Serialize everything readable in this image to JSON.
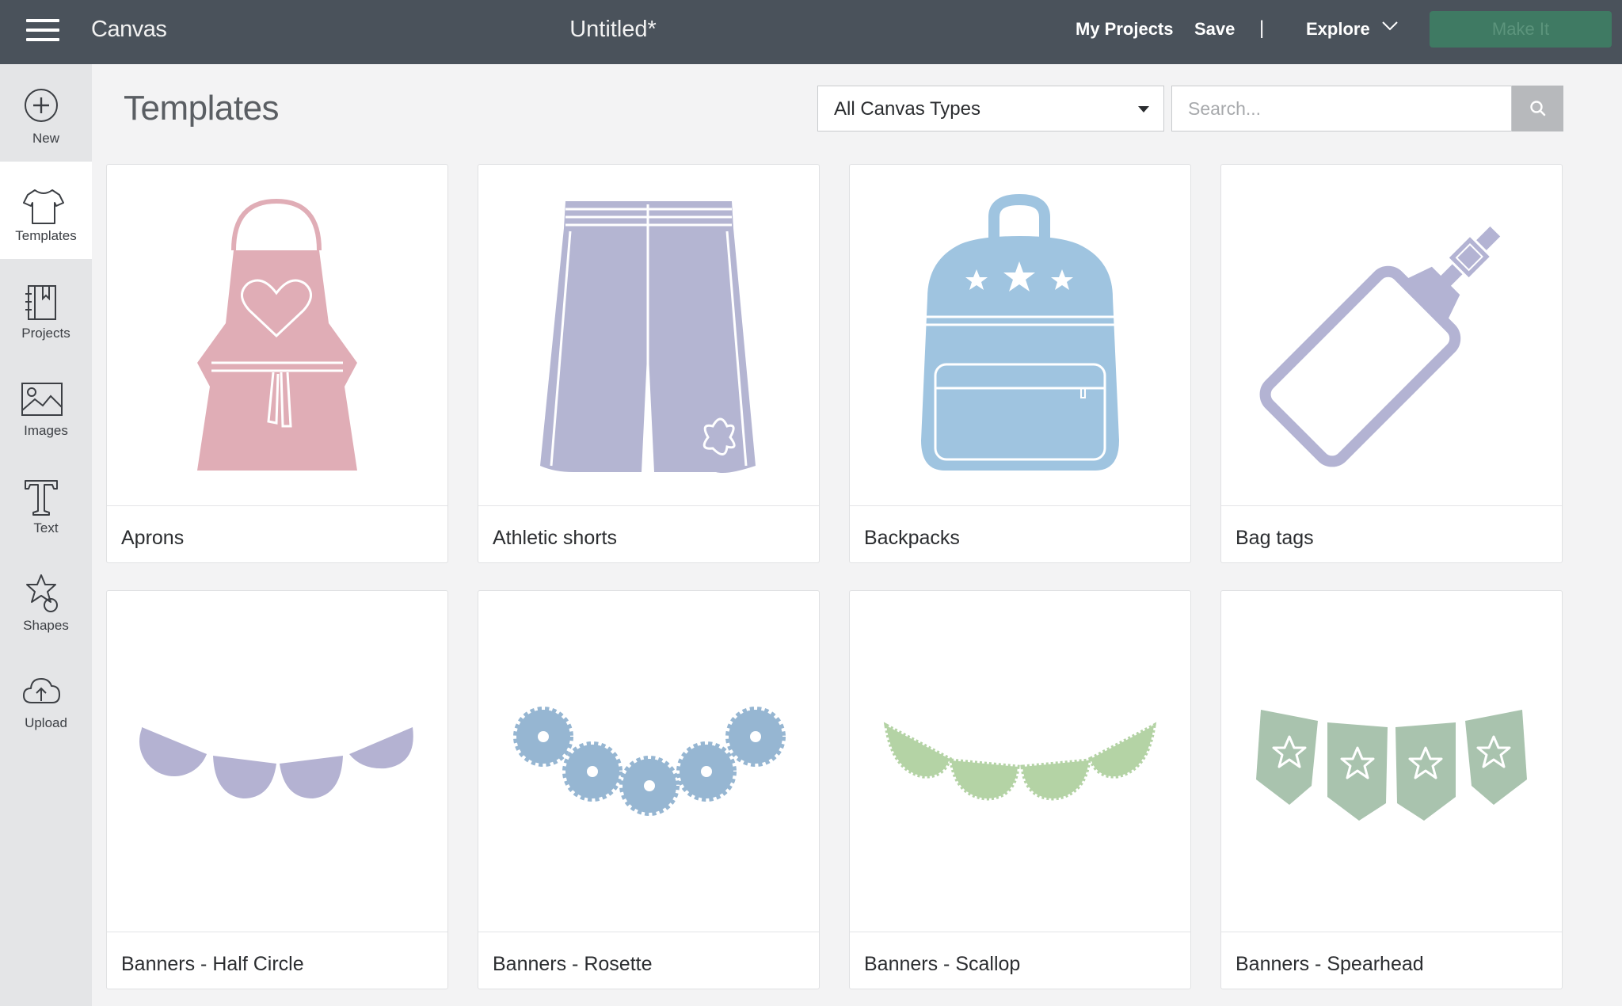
{
  "app": {
    "title": "Canvas",
    "document_title": "Untitled*"
  },
  "topbar": {
    "my_projects": "My Projects",
    "save": "Save",
    "separator": "|",
    "explore": "Explore",
    "make_it": "Make It"
  },
  "sidebar": {
    "items": [
      {
        "label": "New",
        "icon": "plus-circle-icon"
      },
      {
        "label": "Templates",
        "icon": "tshirt-icon"
      },
      {
        "label": "Projects",
        "icon": "book-icon"
      },
      {
        "label": "Images",
        "icon": "image-icon"
      },
      {
        "label": "Text",
        "icon": "text-icon"
      },
      {
        "label": "Shapes",
        "icon": "shapes-icon"
      },
      {
        "label": "Upload",
        "icon": "cloud-upload-icon"
      }
    ]
  },
  "main": {
    "title": "Templates",
    "filter": {
      "selected": "All Canvas Types"
    },
    "search": {
      "placeholder": "Search...",
      "value": ""
    },
    "templates": [
      {
        "label": "Aprons",
        "icon": "apron-icon",
        "color": "#e0adb6"
      },
      {
        "label": "Athletic shorts",
        "icon": "athletic-shorts-icon",
        "color": "#b4b5d2"
      },
      {
        "label": "Backpacks",
        "icon": "backpack-icon",
        "color": "#9fc4e0"
      },
      {
        "label": "Bag tags",
        "icon": "bag-tag-icon",
        "color": "#b3b3d3"
      },
      {
        "label": "Banners - Half Circle",
        "icon": "banner-half-circle-icon",
        "color": "#b4b2d2"
      },
      {
        "label": "Banners - Rosette",
        "icon": "banner-rosette-icon",
        "color": "#96b6d2"
      },
      {
        "label": "Banners - Scallop",
        "icon": "banner-scallop-icon",
        "color": "#b4d3a5"
      },
      {
        "label": "Banners - Spearhead",
        "icon": "banner-spearhead-icon",
        "color": "#a9c3ae"
      }
    ]
  },
  "colors": {
    "topbar": "#4a525b",
    "sidebar": "#e4e5e7",
    "background": "#f3f3f4",
    "make_it_button": "#3f7a63"
  }
}
